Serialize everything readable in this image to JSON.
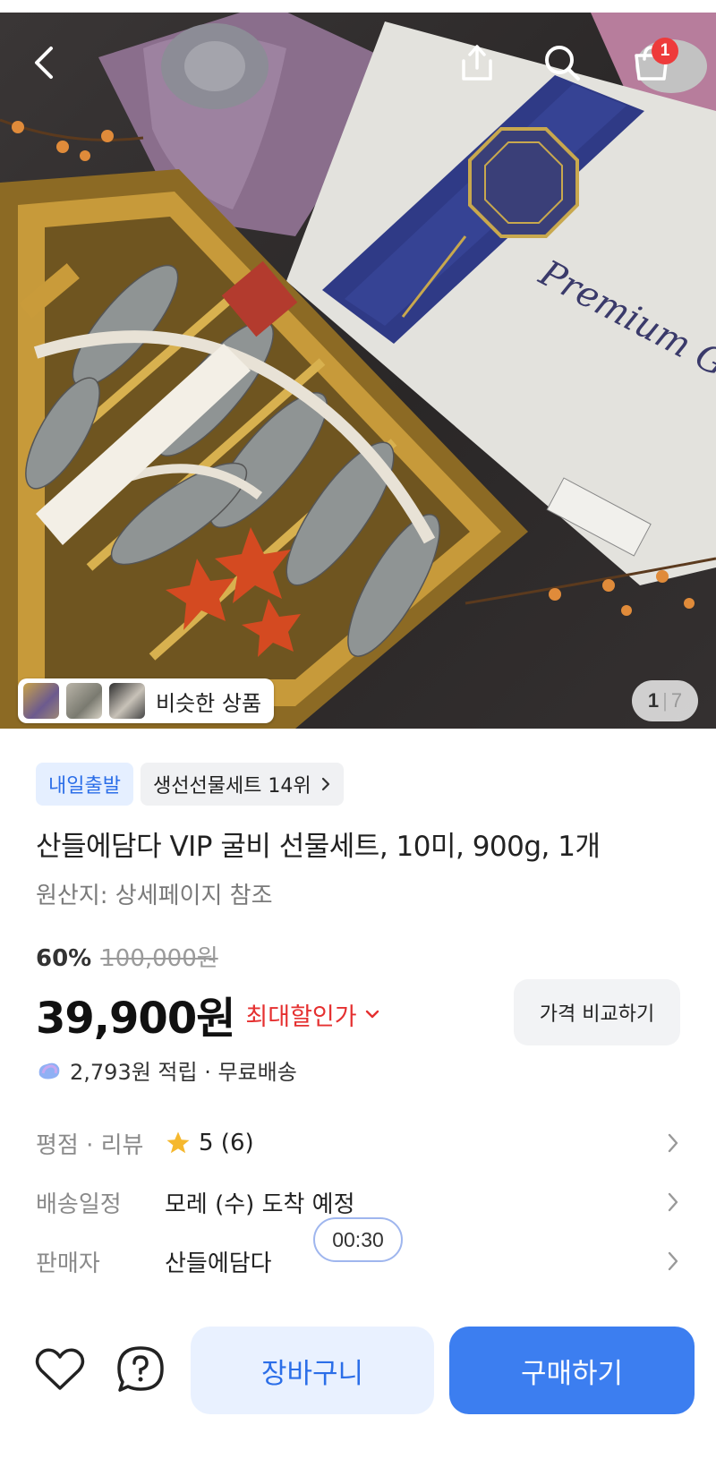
{
  "header": {
    "cart_badge": "1"
  },
  "gallery": {
    "similar_label": "비슷한 상품",
    "pager_current": "1",
    "pager_sep": "|",
    "pager_total": "7"
  },
  "product": {
    "badge_rocket": "내일출발",
    "ranking": "생선선물세트 14위",
    "title": "산들에담다 VIP 굴비 선물세트, 10미, 900g, 1개",
    "origin": "원산지: 상세페이지 참조"
  },
  "pricing": {
    "discount": "60%",
    "original_price": "100,000원",
    "price": "39,900원",
    "max_discount_label": "최대할인가",
    "compare_button": "가격 비교하기",
    "rewards": "2,793원 적립 · 무료배송"
  },
  "info": {
    "rating_label": "평점 · 리뷰",
    "rating_value": "5 (6)",
    "delivery_label": "배송일정",
    "delivery_value": "모레 (수) 도착 예정",
    "seller_label": "판매자",
    "seller_value": "산들에담다"
  },
  "timer": "00:30",
  "bottom": {
    "cart_button": "장바구니",
    "buy_button": "구매하기"
  },
  "colors": {
    "accent_blue": "#3c7ef0",
    "discount_red": "#e53030",
    "badge_red": "#ee3b3b",
    "rating_star": "#f5b82e"
  }
}
